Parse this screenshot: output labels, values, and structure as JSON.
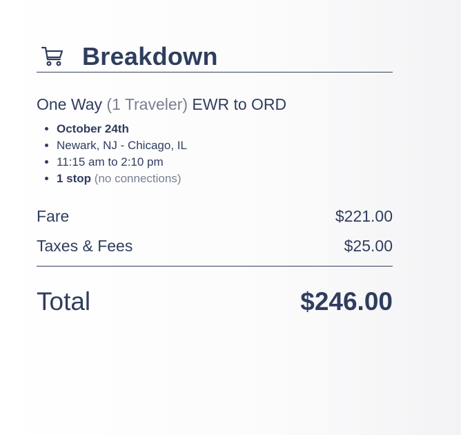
{
  "header": {
    "title": "Breakdown",
    "icon": "shopping-cart-icon"
  },
  "trip": {
    "type": "One Way",
    "travelers": "(1 Traveler)",
    "route": "EWR to ORD"
  },
  "details": {
    "date": "October 24th",
    "cities": "Newark, NJ - Chicago, IL",
    "time": "11:15 am to 2:10 pm",
    "stops": "1 stop",
    "connections": "(no connections)"
  },
  "costs": {
    "fare_label": "Fare",
    "fare_amount": "$221.00",
    "taxes_label": "Taxes & Fees",
    "taxes_amount": "$25.00",
    "total_label": "Total",
    "total_amount": "$246.00"
  }
}
